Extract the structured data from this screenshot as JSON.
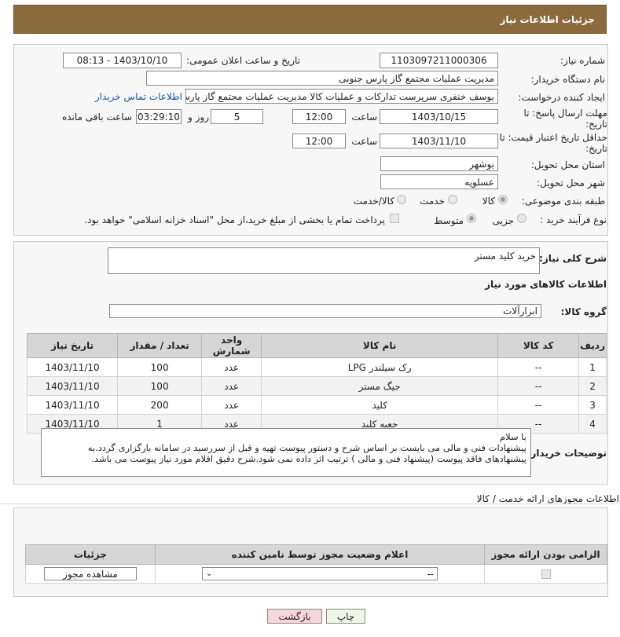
{
  "header": {
    "title": "جزئیات اطلاعات نیاز"
  },
  "form": {
    "need_number_label": "شماره نیاز:",
    "need_number": "1103097211000306",
    "announce_label": "تاریخ و ساعت اعلان عمومی:",
    "announce_value": "1403/10/10 - 08:13",
    "buyer_label": "نام دستگاه خریدار:",
    "buyer_value": "مدیریت عملیات مجتمع گاز پارس جنوبی",
    "creator_label": "ایجاد کننده درخواست:",
    "creator_value": "یوسف خنفری سرپرست تدارکات و عملیات کالا مدیریت عملیات مجتمع گاز پارس",
    "contact_link": "اطلاعات تماس خریدار",
    "deadline_label_1": "مهلت ارسال پاسخ: تا",
    "deadline_label_2": "تاریخ:",
    "deadline_date": "1403/10/15",
    "hour_label": "ساعت",
    "deadline_time": "12:00",
    "days_value": "5",
    "days_label": "روز و",
    "remaining_time": "03:29:10",
    "remaining_label": "ساعت باقی مانده",
    "validity_label_1": "حداقل تاریخ اعتبار قیمت: تا",
    "validity_label_2": "تاریخ:",
    "validity_date": "1403/11/10",
    "validity_time": "12:00",
    "province_label": "استان محل تحویل:",
    "province_value": "بوشهر",
    "city_label": "شهر محل تحویل:",
    "city_value": "عسلویه",
    "category_label": "طبقه بندی موضوعی:",
    "category_options": [
      "کالا",
      "خدمت",
      "کالا/خدمت"
    ],
    "process_label": "نوع فرآیند خرید :",
    "process_options": [
      "جزیی",
      "متوسط"
    ],
    "payment_note": "پرداخت تمام یا بخشی از مبلغ خرید،از محل \"اسناد خزانه اسلامی\" خواهد بود."
  },
  "desc": {
    "label": "شرح کلی نیاز:",
    "value": "خرید کلید مستر"
  },
  "items_section": {
    "title": "اطلاعات کالاهای مورد نیاز",
    "group_label": "گروه کالا:",
    "group_value": "ابزارآلات"
  },
  "table": {
    "headers": [
      "ردیف",
      "کد کالا",
      "نام کالا",
      "واحد شمارش",
      "تعداد / مقدار",
      "تاریخ نیاز"
    ],
    "rows": [
      [
        "1",
        "--",
        "رک سیلندر LPG",
        "عدد",
        "100",
        "1403/11/10"
      ],
      [
        "2",
        "--",
        "جیگ مستر",
        "عدد",
        "100",
        "1403/11/10"
      ],
      [
        "3",
        "--",
        "کلید",
        "عدد",
        "200",
        "1403/11/10"
      ],
      [
        "4",
        "--",
        "جعبه کلید",
        "عدد",
        "1",
        "1403/11/10"
      ]
    ]
  },
  "buyer_notes": {
    "label": "توضیحات خریدار:",
    "lines": [
      "با سلام",
      "پیشنهادات فنی و مالی می بایست بر اساس شرح و دستور پیوست تهیه و قبل از سررسید در سامانه بارگزاری گردد.به",
      "پیشنهادهای فاقد پیوست (پیشنهاد فنی و مالی ) ترتیب اثر داده نمی شود.شرح دقیق اقلام مورد نیاز پیوست می باشد."
    ]
  },
  "permits": {
    "title": "اطلاعات مجوزهای ارائه خدمت / کالا",
    "headers": [
      "الزامی بودن ارائه مجوز",
      "اعلام وضعیت مجوز توسط نامین کننده",
      "جزئیات"
    ],
    "select_value": "--",
    "view_button": "مشاهده مجوز"
  },
  "footer": {
    "print": "چاپ",
    "back": "بازگشت"
  },
  "colors": {
    "header_bg": "#8b6b3e",
    "link": "#1a55b0",
    "back_btn": "#f6d6d6",
    "print_btn": "#eef8e4"
  }
}
